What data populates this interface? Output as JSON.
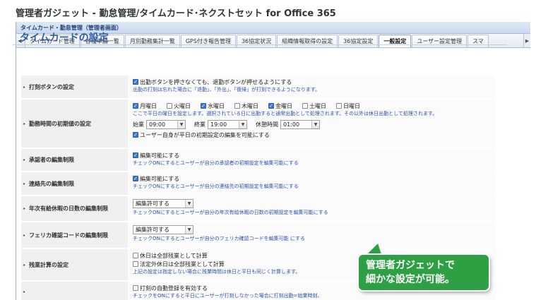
{
  "app": {
    "window_title": "管理者ガジェット - 勤怠管理/タイムカード･ネクストセット for Office 365",
    "panel_title": "タイムカード・勤怠管理（管理者画面）"
  },
  "tabs": [
    {
      "label": "タイムカード管理"
    },
    {
      "label": "各種申請一覧"
    },
    {
      "label": "月別勤務集計一覧"
    },
    {
      "label": "GPS付き報告管理"
    },
    {
      "label": "36協定状況"
    },
    {
      "label": "組織情報取得の設定"
    },
    {
      "label": "36協定設定"
    },
    {
      "label": "一般設定"
    },
    {
      "label": "ユーザー設定管理"
    },
    {
      "label": "スマ"
    }
  ],
  "active_tab": "一般設定",
  "page": {
    "title": "タイムカードの設定"
  },
  "settings": {
    "punch_button": {
      "label": "打刻ボタンの設定",
      "checkbox": "出勤ボタンを押さなくても、退勤ボタンが押せるようにする",
      "checked": true,
      "note": "出勤の打刻は忘れた場合に「退勤」、「外出」、「復帰」が打刻できるようになります。"
    },
    "work_hours": {
      "label": "勤務時間の初期値の設定",
      "days": [
        {
          "name": "月曜日",
          "checked": true
        },
        {
          "name": "火曜日",
          "checked": false
        },
        {
          "name": "水曜日",
          "checked": true
        },
        {
          "name": "木曜日",
          "checked": false
        },
        {
          "name": "金曜日",
          "checked": true
        },
        {
          "name": "土曜日",
          "checked": false
        },
        {
          "name": "日曜日",
          "checked": false
        }
      ],
      "note": "ここで平日の曜日を設定します。選択されている日に出勤すると通常出勤として処理されます。その以外は休日出勤として処理されます。",
      "start_label": "始業",
      "start_value": "09:00",
      "end_label": "終業",
      "end_value": "19:00",
      "break_label": "休憩時間",
      "break_value": "01:00",
      "user_edit_checkbox": "ユーザー自身が平日の初期設定の編集を可能にする",
      "user_edit_checked": true
    },
    "approver": {
      "label": "承認者の編集制限",
      "checkbox": "編集可能にする",
      "checked": true,
      "note": "チェックONにするとユーザーが自分の承認者の初期設定を編集可能にする"
    },
    "contact": {
      "label": "連絡先の編集制限",
      "checkbox": "編集可能にする",
      "checked": true,
      "note": "チェックONにするとユーザーが自分の連絡先の初期設定を編集可能にする"
    },
    "paid_leave": {
      "label": "年次有給休暇の日数の編集制限",
      "select": "編集許可する",
      "note": "チェックONにするとユーザーが自分の年次有給休暇の日数の初期設定を編集可能にする"
    },
    "felica": {
      "label": "フェリカ確認コードの編集制限",
      "select": "編集許可する",
      "note": "チェックONにするとユーザーが自分のフェリカ確認コードを編集可能 にする"
    },
    "overtime": {
      "label": "残業計算の設定",
      "checkbox1": "休日は全部残業として計算",
      "checkbox2": "法定外休日は全部残業として計算",
      "note": "上記の設定は指定しない場合に残業時間は休日と平日も同じく計算します。"
    },
    "auto_punch": {
      "checkbox": "打刻の自動登録を有効する",
      "note": "チェックをONにすると平日にユーザーが打刻しなかった場合に打刻出勤=始業時刻、"
    }
  },
  "callout": {
    "line1": "管理者ガジェットで",
    "line2": "細かな設定が可能。"
  },
  "colors": {
    "accent": "#2a5cab",
    "note_text": "#2a4fb0",
    "callout_bg": "#2ea043",
    "checkbox_on": "#3a78d6"
  }
}
